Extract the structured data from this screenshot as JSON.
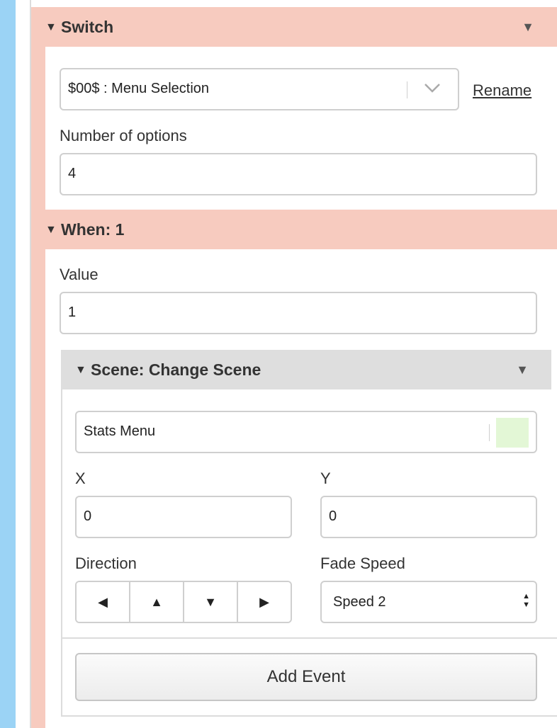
{
  "switch_section": {
    "title": "Switch",
    "variable_value": "$00$ : Menu Selection",
    "rename_label": "Rename",
    "options_label": "Number of options",
    "options_value": "4"
  },
  "when_section": {
    "title": "When: 1",
    "value_label": "Value",
    "value_value": "1"
  },
  "scene_event": {
    "title": "Scene: Change Scene",
    "scene_value": "Stats Menu",
    "x_label": "X",
    "x_value": "0",
    "y_label": "Y",
    "y_value": "0",
    "direction_label": "Direction",
    "direction_buttons": [
      "◀",
      "▲",
      "▼",
      "▶"
    ],
    "fade_speed_label": "Fade Speed",
    "fade_speed_value": "Speed 2"
  },
  "add_event_label": "Add Event",
  "icons": {
    "expanded": "▼",
    "collapse_menu": "▼",
    "dropdown": "chevron-down-icon",
    "select_arrows": "updown-arrows-icon"
  },
  "colors": {
    "section_header": "#f7cbbf",
    "event_header": "#dedede",
    "sidebar_accent": "#9bd3f5",
    "scene_swatch": "#e3f7d6"
  }
}
